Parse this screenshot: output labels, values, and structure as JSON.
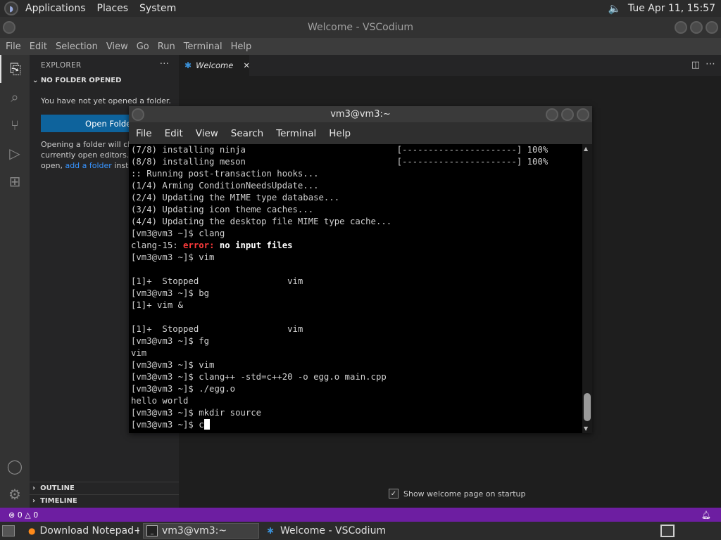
{
  "top_panel": {
    "menus": [
      "Applications",
      "Places",
      "System"
    ],
    "clock": "Tue Apr 11, 15:57"
  },
  "vscodium": {
    "window_title": "Welcome - VSCodium",
    "menu": [
      "File",
      "Edit",
      "Selection",
      "View",
      "Go",
      "Run",
      "Terminal",
      "Help"
    ],
    "sidebar": {
      "header": "EXPLORER",
      "more": "···",
      "section": "NO FOLDER OPENED",
      "message": "You have not yet opened a folder.",
      "open_button": "Open Folder",
      "para_line1": "Opening a folder will close",
      "para_line2": "currently open editors. To",
      "para_line3_prefix": "open, ",
      "para_link": "add a folder",
      "para_line3_suffix": " instead",
      "outline": "OUTLINE",
      "timeline": "TIMELINE"
    },
    "tab": {
      "label": "Welcome",
      "close": "✕"
    },
    "show_welcome": "Show welcome page on startup",
    "status": {
      "errors": "0",
      "warnings": "0"
    }
  },
  "terminal": {
    "title": "vm3@vm3:~",
    "menu": [
      "File",
      "Edit",
      "View",
      "Search",
      "Terminal",
      "Help"
    ],
    "lines": [
      "(7/8) installing ninja                             [----------------------] 100%",
      "(8/8) installing meson                             [----------------------] 100%",
      ":: Running post-transaction hooks...",
      "(1/4) Arming ConditionNeedsUpdate...",
      "(2/4) Updating the MIME type database...",
      "(3/4) Updating icon theme caches...",
      "(4/4) Updating the desktop file MIME type cache...",
      "[vm3@vm3 ~]$ clang"
    ],
    "err_prefix": "clang-15: ",
    "err_word": "error:",
    "err_msg": " no input files",
    "lines2": [
      "[vm3@vm3 ~]$ vim",
      "",
      "[1]+  Stopped                 vim",
      "[vm3@vm3 ~]$ bg",
      "[1]+ vim &",
      "",
      "[1]+  Stopped                 vim",
      "[vm3@vm3 ~]$ fg",
      "vim",
      "[vm3@vm3 ~]$ vim",
      "[vm3@vm3 ~]$ clang++ -std=c++20 -o egg.o main.cpp",
      "[vm3@vm3 ~]$ ./egg.o",
      "hello world",
      "[vm3@vm3 ~]$ mkdir source"
    ],
    "current_prompt": "[vm3@vm3 ~]$ ",
    "current_input": "c"
  },
  "taskbar": {
    "tasks": [
      {
        "label": "Download Notepad+...",
        "icon": "firefox-icon"
      },
      {
        "label": "vm3@vm3:~",
        "icon": "terminal-icon"
      },
      {
        "label": "Welcome - VSCodium",
        "icon": "vscodium-icon"
      }
    ]
  }
}
